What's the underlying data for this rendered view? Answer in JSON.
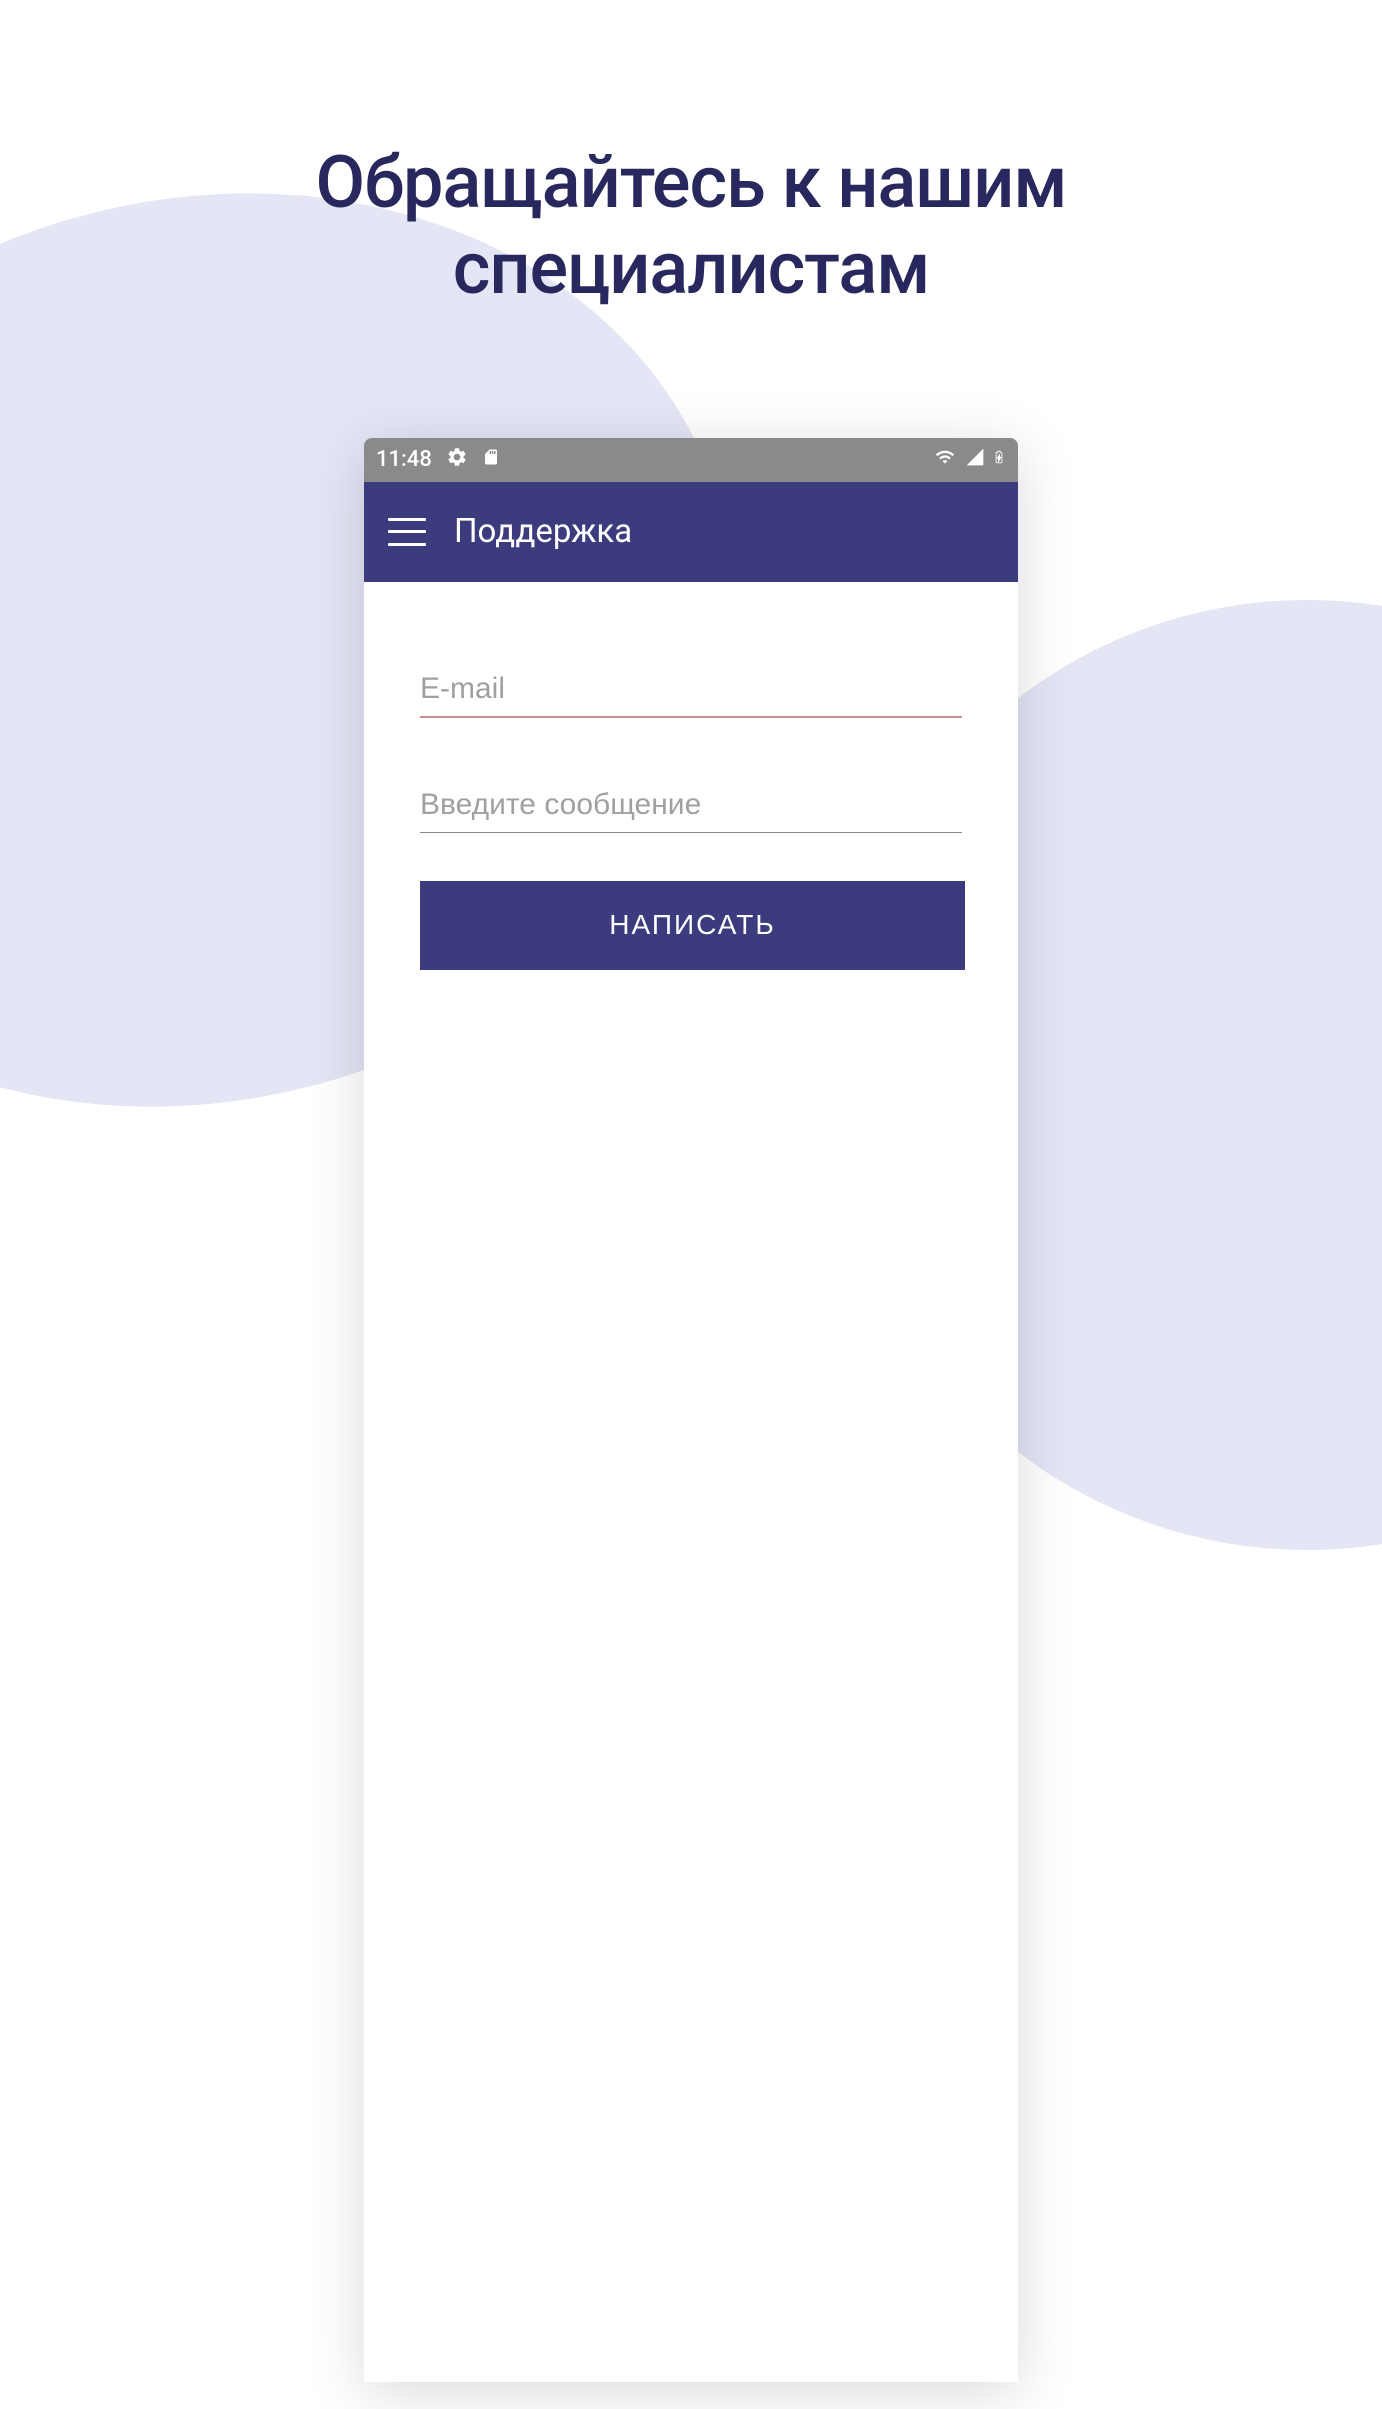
{
  "promo": {
    "heading_line1": "Обращайтесь к нашим",
    "heading_line2": "специалистам"
  },
  "status_bar": {
    "time": "11:48",
    "icons": {
      "settings": "gear-icon",
      "sd": "sd-card-icon",
      "wifi": "wifi-icon",
      "signal": "signal-icon",
      "battery": "battery-charging-icon"
    }
  },
  "app_bar": {
    "title": "Поддержка",
    "menu_icon": "hamburger-icon"
  },
  "form": {
    "email_placeholder": "E-mail",
    "email_value": "",
    "message_placeholder": "Введите сообщение",
    "message_value": "",
    "submit_label": "НАПИСАТЬ"
  },
  "colors": {
    "primary": "#3b3b7e",
    "bg_blob": "#e4e5f5",
    "status_bg": "#8a8a8a",
    "heading": "#28285e",
    "email_underline": "#c99090",
    "message_underline": "#888888"
  }
}
